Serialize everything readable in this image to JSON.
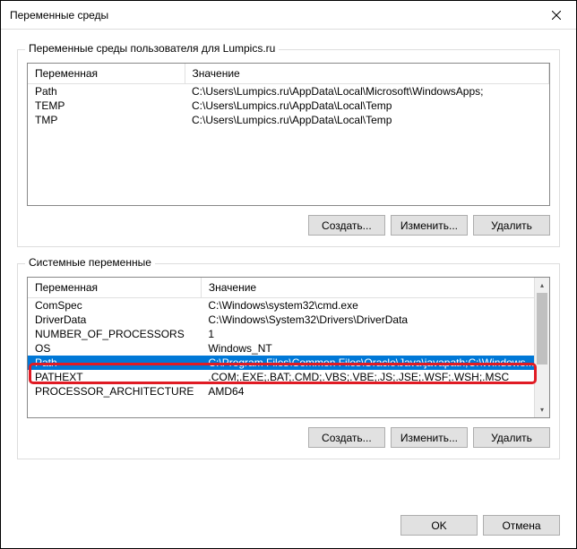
{
  "window": {
    "title": "Переменные среды"
  },
  "user_vars": {
    "group_label": "Переменные среды пользователя для Lumpics.ru",
    "col_var": "Переменная",
    "col_val": "Значение",
    "rows": [
      {
        "name": "Path",
        "value": "C:\\Users\\Lumpics.ru\\AppData\\Local\\Microsoft\\WindowsApps;"
      },
      {
        "name": "TEMP",
        "value": "C:\\Users\\Lumpics.ru\\AppData\\Local\\Temp"
      },
      {
        "name": "TMP",
        "value": "C:\\Users\\Lumpics.ru\\AppData\\Local\\Temp"
      }
    ],
    "btn_new": "Создать...",
    "btn_edit": "Изменить...",
    "btn_del": "Удалить"
  },
  "sys_vars": {
    "group_label": "Системные переменные",
    "col_var": "Переменная",
    "col_val": "Значение",
    "rows": [
      {
        "name": "ComSpec",
        "value": "C:\\Windows\\system32\\cmd.exe"
      },
      {
        "name": "DriverData",
        "value": "C:\\Windows\\System32\\Drivers\\DriverData"
      },
      {
        "name": "NUMBER_OF_PROCESSORS",
        "value": "1"
      },
      {
        "name": "OS",
        "value": "Windows_NT"
      },
      {
        "name": "Path",
        "value": "C:\\Program Files\\Common Files\\Oracle\\Java\\javapath;C:\\Windows..."
      },
      {
        "name": "PATHEXT",
        "value": ".COM;.EXE;.BAT;.CMD;.VBS;.VBE;.JS;.JSE;.WSF;.WSH;.MSC"
      },
      {
        "name": "PROCESSOR_ARCHITECTURE",
        "value": "AMD64"
      }
    ],
    "selected_index": 4,
    "btn_new": "Создать...",
    "btn_edit": "Изменить...",
    "btn_del": "Удалить"
  },
  "footer": {
    "ok": "OK",
    "cancel": "Отмена"
  }
}
